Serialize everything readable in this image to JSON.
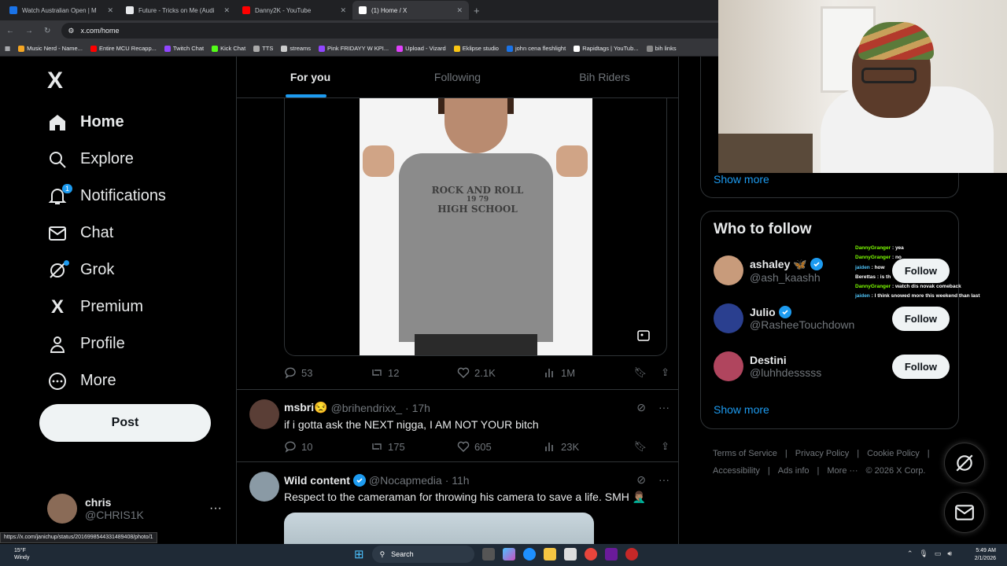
{
  "browser": {
    "tabs": [
      {
        "title": "Watch Australian Open | M",
        "color": "#1a73e8"
      },
      {
        "title": "Future - Tricks on Me (Audi",
        "color": "#e8eaed"
      },
      {
        "title": "Danny2K - YouTube",
        "color": "#ff0000"
      },
      {
        "title": "(1) Home / X",
        "color": "#ffffff"
      }
    ],
    "url": "x.com/home",
    "bookmarks": [
      "Music Nerd - Name...",
      "Entire MCU Recapp...",
      "Twitch Chat",
      "Kick Chat",
      "TTS",
      "streams",
      "Pink FRIDAYY W KPI...",
      "Upload - Vizard",
      "Eklipse studio",
      "john cena fleshlight",
      "Rapidtags | YouTub...",
      "bih links"
    ],
    "status_url": "https://x.com/janichup/status/2016998544331489408/photo/1"
  },
  "nav": {
    "logo": "X",
    "items": [
      {
        "label": "Home",
        "icon": "home-icon",
        "active": true
      },
      {
        "label": "Explore",
        "icon": "search-icon"
      },
      {
        "label": "Notifications",
        "icon": "bell-icon",
        "badge": "1"
      },
      {
        "label": "Chat",
        "icon": "mail-icon"
      },
      {
        "label": "Grok",
        "icon": "grok-icon"
      },
      {
        "label": "Premium",
        "icon": "x-premium-icon"
      },
      {
        "label": "Profile",
        "icon": "person-icon"
      },
      {
        "label": "More",
        "icon": "more-circle-icon"
      }
    ],
    "post_label": "Post",
    "account": {
      "name": "chris",
      "handle": "@CHRIS1K",
      "more": "···"
    }
  },
  "feed": {
    "tabs": [
      "For you",
      "Following",
      "Bih Riders"
    ],
    "image": {
      "shirt_text_1": "ROCK AND ROLL",
      "shirt_text_2": "19 79",
      "shirt_text_3": "HIGH SCHOOL"
    },
    "first_actions": {
      "replies": "53",
      "reposts": "12",
      "likes": "2.1K",
      "views": "1M"
    },
    "tweets": [
      {
        "name": "msbri😒",
        "handle": "@brihendrixx_",
        "time": "· 17h",
        "text": "if i gotta ask the NEXT nigga, I AM NOT YOUR bitch",
        "replies": "10",
        "reposts": "175",
        "likes": "605",
        "views": "23K"
      },
      {
        "name": "Wild content",
        "handle": "@Nocapmedia",
        "time": "· 11h",
        "text": "Respect to the cameraman for throwing his camera to save a life. SMH 🤦🏽‍♂️"
      }
    ]
  },
  "sidebar": {
    "show_more": "Show more",
    "who_to_follow": "Who to follow",
    "suggestions": [
      {
        "name": "ashaley 🦋",
        "handle": "@ash_kaashh",
        "follow": "Follow",
        "color": "#c89b7b"
      },
      {
        "name": "Julio",
        "handle": "@RasheeTouchdown",
        "follow": "Follow",
        "color": "#2a3f8f"
      },
      {
        "name": "Destini",
        "handle": "@luhhdesssss",
        "follow": "Follow",
        "color": "#b0455e"
      }
    ],
    "show_more_2": "Show more",
    "footer": [
      "Terms of Service",
      "|",
      "Privacy Policy",
      "|",
      "Cookie Policy",
      "|",
      "Accessibility",
      "|",
      "Ads info",
      "|",
      "More ···",
      "© 2026 X Corp."
    ]
  },
  "chat_overlay": [
    {
      "user": "DannyGranger",
      "msg": "yea"
    },
    {
      "user": "DannyGranger",
      "msg": "no"
    },
    {
      "user": "jaiden",
      "msg": "how"
    },
    {
      "user": "Berettas",
      "msg": "is th"
    },
    {
      "user": "DannyGranger",
      "msg": "watch dis novak comeback"
    },
    {
      "user": "jaiden",
      "msg": "I think snowed more this weekend than last"
    }
  ],
  "taskbar": {
    "temp": "15°F",
    "weather": "Windy",
    "search": "Search",
    "time": "5:49 AM",
    "date": "2/1/2026"
  }
}
